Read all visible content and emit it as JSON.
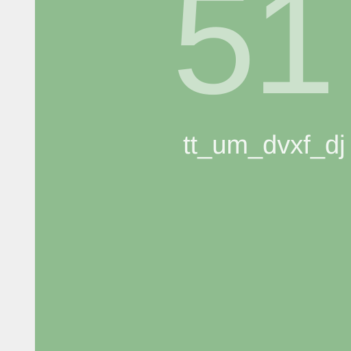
{
  "tile": {
    "number": "51",
    "label": "tt_um_dvxf_dj",
    "background_color": "#8fbc8f",
    "text_color": "#ffffff"
  },
  "page": {
    "background_color": "#efefef"
  }
}
